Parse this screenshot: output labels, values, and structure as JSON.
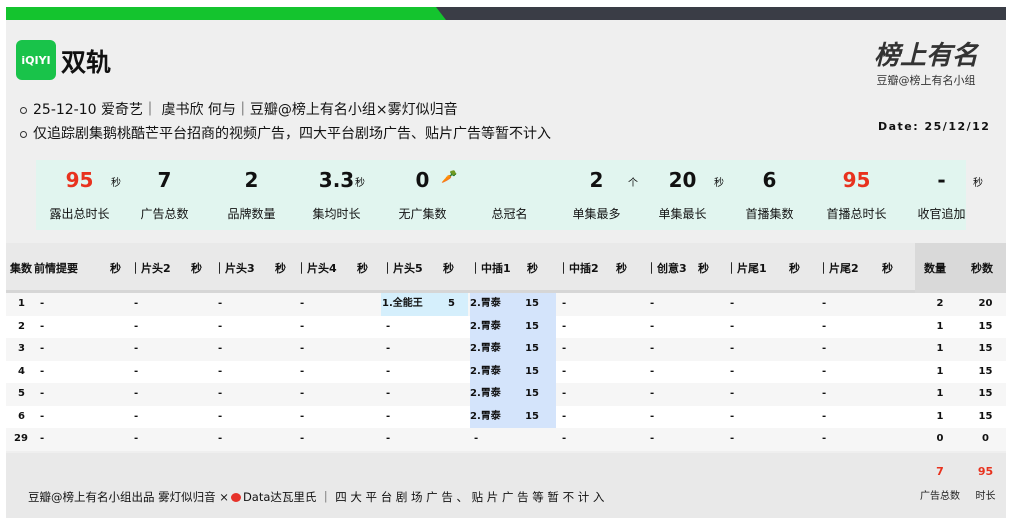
{
  "header": {
    "logo": "iQIYI",
    "title": "双轨",
    "info_lines": [
      "25-12-10 爱奇艺｜ 虞书欣 何与｜豆瓣@榜上有名小组×雾灯似归音",
      "仅追踪剧集鹅桃酷芒平台招商的视频广告，四大平台剧场广告、贴片广告等暂不计入"
    ],
    "brand_logo": "榜上有名",
    "brand_sub": "豆瓣@榜上有名小组",
    "date": "Date: 25/12/12"
  },
  "stats": [
    {
      "value": "95",
      "unit": "秒",
      "label": "露出总时长",
      "red": true
    },
    {
      "value": "7",
      "unit": "",
      "label": "广告总数"
    },
    {
      "value": "2",
      "unit": "",
      "label": "品牌数量"
    },
    {
      "value": "3.3",
      "unit": "秒",
      "label": "集均时长"
    },
    {
      "value": "0",
      "unit": "🥕",
      "label": "无广集数"
    },
    {
      "value": "",
      "unit": "",
      "label": "总冠名"
    },
    {
      "value": "2",
      "unit": "个",
      "label": "单集最多"
    },
    {
      "value": "20",
      "unit": "秒",
      "label": "单集最长"
    },
    {
      "value": "6",
      "unit": "",
      "label": "首播集数"
    },
    {
      "value": "95",
      "unit": "",
      "label": "首播总时长",
      "red": true
    },
    {
      "value": "-",
      "unit": "秒",
      "label": "收官追加"
    }
  ],
  "table": {
    "ep_header": "集数",
    "slots": [
      "前情提要",
      "｜片头2",
      "｜片头3",
      "｜片头4",
      "｜片头5",
      "｜中插1",
      "｜中插2",
      "｜创意3",
      "｜片尾1",
      "｜片尾2"
    ],
    "sec_header": "秒",
    "count_header": "数量",
    "secs_header": "秒数",
    "rows": [
      {
        "ep": "1",
        "cells": [
          [
            "-",
            ""
          ],
          [
            "-",
            ""
          ],
          [
            "-",
            ""
          ],
          [
            "-",
            ""
          ],
          [
            "1.全能王",
            "5"
          ],
          [
            "2.胃泰",
            "15"
          ],
          [
            "-",
            ""
          ],
          [
            "-",
            ""
          ],
          [
            "-",
            ""
          ],
          [
            "-",
            ""
          ]
        ],
        "count": "2",
        "secs": "20"
      },
      {
        "ep": "2",
        "cells": [
          [
            "-",
            ""
          ],
          [
            "-",
            ""
          ],
          [
            "-",
            ""
          ],
          [
            "-",
            ""
          ],
          [
            "-",
            ""
          ],
          [
            "2.胃泰",
            "15"
          ],
          [
            "-",
            ""
          ],
          [
            "-",
            ""
          ],
          [
            "-",
            ""
          ],
          [
            "-",
            ""
          ]
        ],
        "count": "1",
        "secs": "15"
      },
      {
        "ep": "3",
        "cells": [
          [
            "-",
            ""
          ],
          [
            "-",
            ""
          ],
          [
            "-",
            ""
          ],
          [
            "-",
            ""
          ],
          [
            "-",
            ""
          ],
          [
            "2.胃泰",
            "15"
          ],
          [
            "-",
            ""
          ],
          [
            "-",
            ""
          ],
          [
            "-",
            ""
          ],
          [
            "-",
            ""
          ]
        ],
        "count": "1",
        "secs": "15"
      },
      {
        "ep": "4",
        "cells": [
          [
            "-",
            ""
          ],
          [
            "-",
            ""
          ],
          [
            "-",
            ""
          ],
          [
            "-",
            ""
          ],
          [
            "-",
            ""
          ],
          [
            "2.胃泰",
            "15"
          ],
          [
            "-",
            ""
          ],
          [
            "-",
            ""
          ],
          [
            "-",
            ""
          ],
          [
            "-",
            ""
          ]
        ],
        "count": "1",
        "secs": "15"
      },
      {
        "ep": "5",
        "cells": [
          [
            "-",
            ""
          ],
          [
            "-",
            ""
          ],
          [
            "-",
            ""
          ],
          [
            "-",
            ""
          ],
          [
            "-",
            ""
          ],
          [
            "2.胃泰",
            "15"
          ],
          [
            "-",
            ""
          ],
          [
            "-",
            ""
          ],
          [
            "-",
            ""
          ],
          [
            "-",
            ""
          ]
        ],
        "count": "1",
        "secs": "15"
      },
      {
        "ep": "6",
        "cells": [
          [
            "-",
            ""
          ],
          [
            "-",
            ""
          ],
          [
            "-",
            ""
          ],
          [
            "-",
            ""
          ],
          [
            "-",
            ""
          ],
          [
            "2.胃泰",
            "15"
          ],
          [
            "-",
            ""
          ],
          [
            "-",
            ""
          ],
          [
            "-",
            ""
          ],
          [
            "-",
            ""
          ]
        ],
        "count": "1",
        "secs": "15"
      },
      {
        "ep": "29",
        "cells": [
          [
            "-",
            ""
          ],
          [
            "-",
            ""
          ],
          [
            "-",
            ""
          ],
          [
            "-",
            ""
          ],
          [
            "-",
            ""
          ],
          [
            "-",
            ""
          ],
          [
            "-",
            ""
          ],
          [
            "-",
            ""
          ],
          [
            "-",
            ""
          ],
          [
            "-",
            ""
          ]
        ],
        "count": "0",
        "secs": "0"
      }
    ]
  },
  "footer": {
    "credit": "豆瓣@榜上有名小组出品 雾灯似归音 ×",
    "data_credit": "Data达瓦里氏",
    "note": "｜ 四 大 平 台 剧 场 广 告 、 贴 片 广 告 等 暂 不 计 入",
    "total_count": "7",
    "total_secs": "95",
    "total_count_label": "广告总数",
    "total_secs_label": "时长"
  },
  "colors": {
    "accent_green": "#14c42e",
    "red": "#e8321e",
    "stats_bg": "#e1f5ef"
  }
}
